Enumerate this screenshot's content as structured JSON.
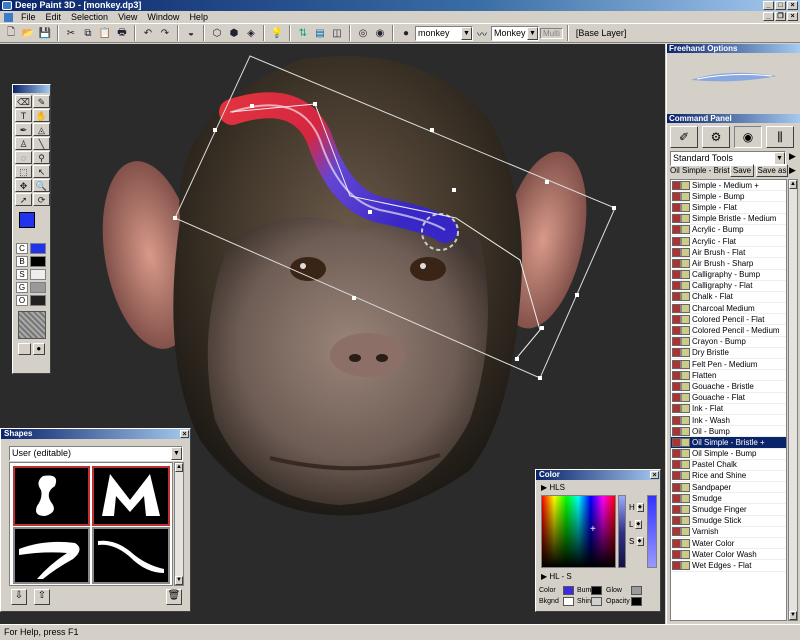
{
  "window": {
    "title": "Deep Paint 3D - [monkey.dp3]"
  },
  "menu": [
    "File",
    "Edit",
    "Selection",
    "View",
    "Window",
    "Help"
  ],
  "toolbar": {
    "model_select": "monkey",
    "material_select": "Monkey S",
    "multi_label": "Multi",
    "layer_label": "[Base Layer]"
  },
  "toolbox": {
    "swatches": [
      {
        "letter": "C",
        "color": "#2233ee"
      },
      {
        "letter": "B",
        "color": "#000000"
      },
      {
        "letter": "S",
        "color": "#eeeeee"
      },
      {
        "letter": "G",
        "color": "#9a9a9a"
      },
      {
        "letter": "O",
        "color": "#222222"
      }
    ]
  },
  "shapes_palette": {
    "title": "Shapes",
    "set_select": "User (editable)"
  },
  "color_palette": {
    "title": "Color",
    "mode_label": "HLS",
    "strip_label": "HL - S",
    "sliders": [
      "H",
      "L",
      "S"
    ],
    "channels": [
      {
        "label": "Color",
        "color": "#3a2bdc"
      },
      {
        "label": "Bump",
        "color": "#000000"
      },
      {
        "label": "Glow",
        "color": "#9a9a9a"
      },
      {
        "label": "Bkgnd",
        "color": "#ffffff"
      },
      {
        "label": "Shine",
        "color": "#d0d0d0"
      },
      {
        "label": "Opacity",
        "color": "#000000"
      }
    ]
  },
  "freehand_options": {
    "title": "Freehand Options"
  },
  "command_panel": {
    "title": "Command Panel",
    "tools_select": "Standard Tools",
    "current_brush": "Oil Simple - Bristle",
    "save_label": "Save",
    "save_as_label": "Save as",
    "brushes": [
      "Simple - Medium +",
      "Simple - Bump",
      "Simple - Flat",
      "Simple Bristle - Medium",
      "Acrylic - Bump",
      "Acrylic - Flat",
      "Air Brush - Flat",
      "Air Brush - Sharp",
      "Calligraphy - Bump",
      "Calligraphy - Flat",
      "Chalk - Flat",
      "Charcoal Medium",
      "Colored Pencil - Flat",
      "Colored Pencil - Medium",
      "Crayon - Bump",
      "Dry Bristle",
      "Felt Pen - Medium",
      "Flatten",
      "Gouache - Bristle",
      "Gouache - Flat",
      "Ink - Flat",
      "Ink - Wash",
      "Oil - Bump",
      "Oil Simple - Bristle +",
      "Oil Simple - Bump",
      "Pastel Chalk",
      "Rice and Shine",
      "Sandpaper",
      "Smudge",
      "Smudge Finger",
      "Smudge Stick",
      "Varnish",
      "Water Color",
      "Water Color Wash",
      "Wet Edges - Flat"
    ],
    "selected_index": 23
  },
  "status": {
    "text": "For Help, press F1"
  }
}
